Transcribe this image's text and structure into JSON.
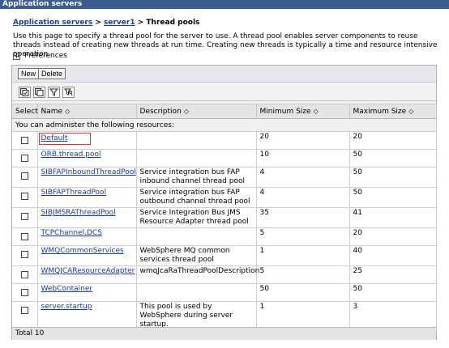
{
  "window": {
    "title": "Application servers"
  },
  "breadcrumb": {
    "root": "Application servers",
    "sep1": " > ",
    "server": "server1",
    "sep2": " > ",
    "current": "Thread pools"
  },
  "description": "Use this page to specify a thread pool for the server to use. A thread pool enables server components to reuse threads instead of creating new threads at run time. Creating new threads is typically a time and resource intensive operation.",
  "preferences": {
    "toggle": "+",
    "label": "Preferences"
  },
  "toolbar": {
    "new_label": "New",
    "delete_label": "Delete"
  },
  "icons": [
    "select-all-icon",
    "deselect-all-icon",
    "filter-icon",
    "show-filter-icon"
  ],
  "table": {
    "columns": {
      "select": "Select",
      "name": "Name",
      "description": "Description",
      "min": "Minimum Size",
      "max": "Maximum Size"
    },
    "sort_glyph": "◇",
    "resources_note": "You can administer the following resources:",
    "rows": [
      {
        "name": "Default",
        "description": "",
        "min": "20",
        "max": "20"
      },
      {
        "name": "ORB.thread.pool",
        "description": "",
        "min": "10",
        "max": "50"
      },
      {
        "name": "SIBFAPInboundThreadPool",
        "description": "Service integration bus FAP inbound channel thread pool",
        "min": "4",
        "max": "50"
      },
      {
        "name": "SIBFAPThreadPool",
        "description": "Service integration bus FAP outbound channel thread pool",
        "min": "4",
        "max": "50"
      },
      {
        "name": "SIBJMSRAThreadPool",
        "description": "Service Integration Bus JMS Resource Adapter thread pool",
        "min": "35",
        "max": "41"
      },
      {
        "name": "TCPChannel.DCS",
        "description": "",
        "min": "5",
        "max": "20"
      },
      {
        "name": "WMQCommonServices",
        "description": "WebSphere MQ common services thread pool",
        "min": "1",
        "max": "40"
      },
      {
        "name": "WMQJCAResourceAdapter",
        "description": "wmqJcaRaThreadPoolDescription",
        "min": "5",
        "max": "25"
      },
      {
        "name": "WebContainer",
        "description": "",
        "min": "50",
        "max": "50"
      },
      {
        "name": "server.startup",
        "description": "This pool is used by WebSphere during server startup.",
        "min": "1",
        "max": "3"
      }
    ],
    "total": "Total 10"
  }
}
